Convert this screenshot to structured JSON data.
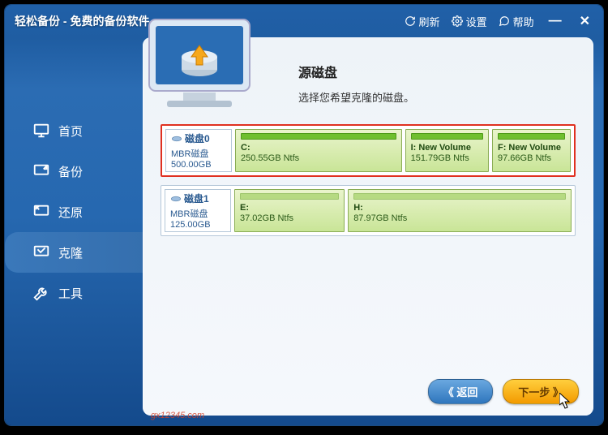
{
  "app": {
    "title": "轻松备份 - 免费的备份软件"
  },
  "titlebar": {
    "refresh": "刷新",
    "settings": "设置",
    "help": "帮助"
  },
  "nav": {
    "home": "首页",
    "backup": "备份",
    "restore": "还原",
    "clone": "克隆",
    "tools": "工具"
  },
  "page": {
    "title": "源磁盘",
    "subtitle": "选择您希望克隆的磁盘。"
  },
  "disks": [
    {
      "name": "磁盘0",
      "type": "MBR磁盘",
      "size": "500.00GB",
      "selected": true,
      "partitions": [
        {
          "label": "C:",
          "size": "250.55GB Ntfs",
          "flex": 3
        },
        {
          "label": "I: New Volume",
          "size": "151.79GB Ntfs",
          "flex": 1.4
        },
        {
          "label": "F: New Volume",
          "size": "97.66GB Ntfs",
          "flex": 1.3
        }
      ]
    },
    {
      "name": "磁盘1",
      "type": "MBR磁盘",
      "size": "125.00GB",
      "selected": false,
      "partitions": [
        {
          "label": "E:",
          "size": "37.02GB Ntfs",
          "flex": 1.4
        },
        {
          "label": "H:",
          "size": "87.97GB Ntfs",
          "flex": 3
        }
      ]
    }
  ],
  "footer": {
    "back": "《 返回",
    "next": "下一步 》"
  },
  "watermark": "gx12345.com"
}
